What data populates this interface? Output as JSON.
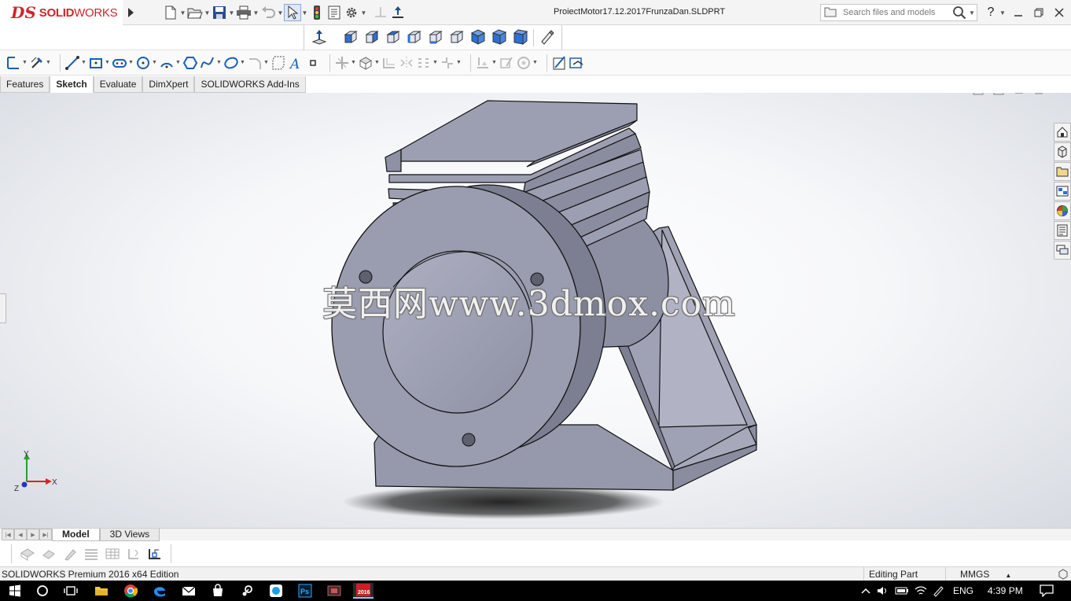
{
  "app": {
    "logo_ds": "DS",
    "logo_solid": "SOLID",
    "logo_works": "WORKS",
    "window_title": "ProiectMotor17.12.2017FrunzaDan.SLDPRT",
    "search_placeholder": "Search files and models",
    "help_label": "?"
  },
  "quick_access": [
    {
      "icon": "new-document-icon"
    },
    {
      "icon": "open-folder-icon"
    },
    {
      "icon": "save-icon"
    },
    {
      "icon": "print-icon"
    },
    {
      "icon": "undo-icon"
    },
    {
      "icon": "select-arrow-icon"
    },
    {
      "icon": "rebuild-traffic-light-icon"
    },
    {
      "icon": "file-properties-icon"
    },
    {
      "icon": "options-gear-icon"
    }
  ],
  "command_tabs": [
    {
      "label": "Features",
      "active": false
    },
    {
      "label": "Sketch",
      "active": true
    },
    {
      "label": "Evaluate",
      "active": false
    },
    {
      "label": "DimXpert",
      "active": false
    },
    {
      "label": "SOLIDWORKS Add-Ins",
      "active": false
    }
  ],
  "viewport": {
    "watermark": "莫西网www.3dmox.com",
    "triad": {
      "x": "X",
      "y": "Y",
      "z": "Z"
    }
  },
  "bottom_tabs": [
    {
      "label": "Model",
      "active": true
    },
    {
      "label": "3D Views",
      "active": false
    }
  ],
  "status": {
    "edition": "SOLIDWORKS Premium 2016 x64 Edition",
    "mode": "Editing Part",
    "units": "MMGS"
  },
  "taskbar": {
    "language": "ENG",
    "time": "4:39 PM",
    "solidworks_badge": "2016"
  },
  "colors": {
    "brand_red": "#d2232a",
    "model_face": "#9a9caf",
    "model_face_dark": "#7b7d90",
    "model_face_light": "#b6b7c9"
  }
}
